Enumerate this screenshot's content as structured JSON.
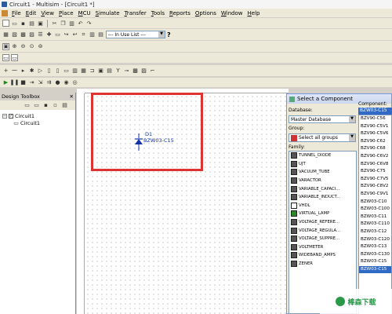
{
  "window": {
    "title": "Circuit1 - Multisim - [Circuit1 *]"
  },
  "menu": [
    "File",
    "Edit",
    "View",
    "Place",
    "MCU",
    "Simulate",
    "Transfer",
    "Tools",
    "Reports",
    "Options",
    "Window",
    "Help"
  ],
  "toolbar": {
    "in_use_list": "--- In Use List ---",
    "help": "?"
  },
  "design_toolbox": {
    "title": "Design Toolbox",
    "tree": [
      {
        "label": "Circuit1"
      },
      {
        "label": "Circuit1"
      }
    ]
  },
  "canvas": {
    "component_ref": "D1",
    "component_part": "BZW03-C15"
  },
  "dialog": {
    "title": "Select a Component",
    "database_label": "Database:",
    "database_value": "Master Database",
    "group_label": "Group:",
    "group_value": "Select all groups",
    "family_label": "Family:",
    "component_label": "Component:",
    "component_value": "BZW03-C15",
    "families": [
      "TUNNEL_DIODE",
      "UJT",
      "VACUUM_TUBE",
      "VARACTOR",
      "VARIABLE_CAPACI...",
      "VARIABLE_INDUCT...",
      "VHDL",
      "VIRTUAL_LAMP",
      "VOLTAGE_REFERE...",
      "VOLTAGE_REGULA...",
      "VOLTAGE_SUPPRE...",
      "VOLTMETER",
      "WIDEBAND_AMPS",
      "ZENER"
    ],
    "components": [
      "BZV90-C56",
      "BZV90-C5V1",
      "BZV90-C5V6",
      "BZV90-C62",
      "BZV90-C68",
      "BZV90-C6V2",
      "BZV90-C6V8",
      "BZV90-C75",
      "BZV90-C7V5",
      "BZV90-C8V2",
      "BZV90-C9V1",
      "BZW03-C10",
      "BZW03-C100",
      "BZW03-C11",
      "BZW03-C110",
      "BZW03-C12",
      "BZW03-C120",
      "BZW03-C13",
      "BZW03-C130",
      "BZW03-C15",
      "BZW03-C15"
    ]
  },
  "watermark": {
    "text": "棒森下载"
  }
}
